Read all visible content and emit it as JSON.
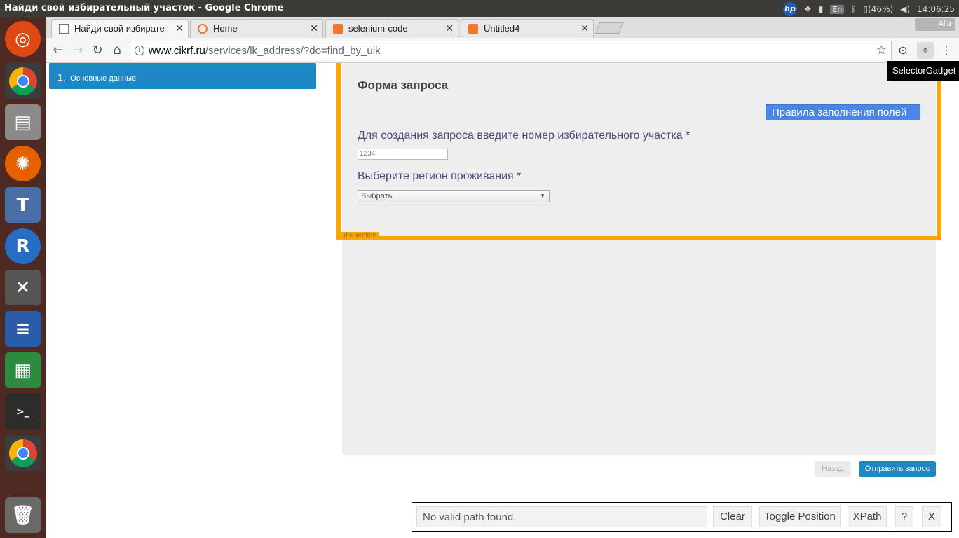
{
  "topbar": {
    "window_title": "Найди свой избирательный участок - Google Chrome",
    "hp": "hp",
    "lang": "En",
    "battery": "(46%)",
    "time": "14:06:25"
  },
  "launcher": {
    "items": [
      "ubuntu-icon",
      "chrome-icon",
      "files-icon",
      "firefox-icon",
      "texmaker-icon",
      "r-icon",
      "settings-tools-icon",
      "writer-icon",
      "calc-icon",
      "terminal-icon",
      "chrome-icon",
      "trash-icon"
    ]
  },
  "tabs": [
    {
      "label": "Найди свой избирате",
      "close": "✕"
    },
    {
      "label": "Home",
      "close": "✕"
    },
    {
      "label": "selenium-code",
      "close": "✕"
    },
    {
      "label": "Untitled4",
      "close": "✕"
    }
  ],
  "profile": {
    "name": "Alla"
  },
  "toolbar": {
    "back": "←",
    "forward": "→",
    "reload": "↻",
    "home": "⌂",
    "url_host": "www.cikrf.ru",
    "url_path": "/services/lk_address/?do=find_by_uik",
    "star": "☆",
    "menu": "⋮"
  },
  "tooltip": {
    "text": "SelectorGadget"
  },
  "steps": {
    "number": "1.",
    "label": "Основные данные"
  },
  "form": {
    "title": "Форма запроса",
    "rules_button": "Правила заполнения полей",
    "uik_label": "Для создания запроса введите номер избирательного участка *",
    "uik_placeholder": "1234",
    "region_label": "Выберите регион проживания *",
    "region_selected": "Выбрать...",
    "highlight_label": "div section"
  },
  "actions": {
    "back": "Назад",
    "send": "Отправить запрос"
  },
  "selector_gadget": {
    "path_text": "No valid path found.",
    "clear": "Clear",
    "toggle": "Toggle Position",
    "xpath": "XPath",
    "help": "?",
    "close": "X"
  },
  "colors": {
    "accent": "#1e88c7",
    "highlight": "#ffa500",
    "rules_button": "#4a86e8",
    "launcher_bg": "#4e2a23"
  }
}
